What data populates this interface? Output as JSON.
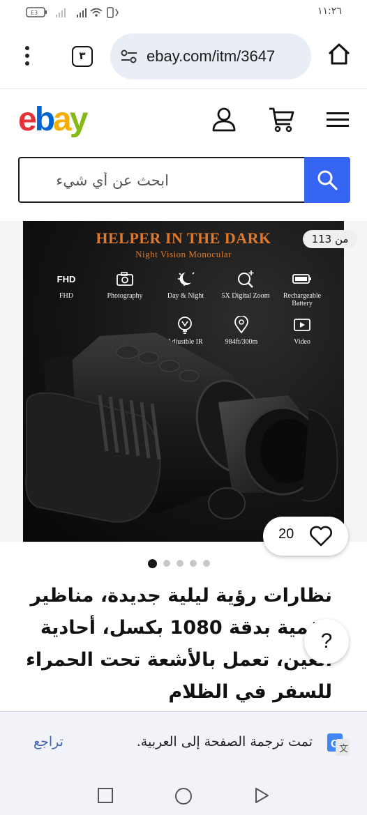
{
  "status_bar": {
    "time": "١١:٢٦"
  },
  "browser": {
    "tab_count": "٣",
    "url": "ebay.com/itm/3647"
  },
  "ebay": {
    "logo_text": [
      "e",
      "b",
      "a",
      "y"
    ],
    "brand_colors": [
      "#e53238",
      "#0064d2",
      "#f5af02",
      "#86b817"
    ],
    "search_placeholder": "ابحث عن أي شيء",
    "search_button_color": "#3665f3"
  },
  "gallery": {
    "image_counter": "من 113",
    "headline": "HELPER IN THE DARK",
    "subline": "Night Vision Monocular",
    "features": [
      {
        "label": "FHD",
        "icon": "fhd-icon"
      },
      {
        "label": "Photography",
        "icon": "camera-icon"
      },
      {
        "label": "Day & Night",
        "icon": "day-night-icon"
      },
      {
        "label": "5X Digital Zoom",
        "icon": "zoom-icon"
      },
      {
        "label": "Rechargeable Battery",
        "icon": "battery-icon"
      },
      {
        "label": "Adjustble IR",
        "icon": "ir-icon"
      },
      {
        "label": "984ft/300m",
        "icon": "location-icon"
      },
      {
        "label": "Video",
        "icon": "video-icon"
      }
    ],
    "watch_count": "20",
    "page_dots": 5,
    "active_dot": 0
  },
  "product": {
    "title": "نظارات رؤية ليلية جديدة، مناظير رقمية بدقة 1080 بكسل، أحادية العين، تعمل بالأشعة تحت الحمراء للسفر في الظلام"
  },
  "help_button": "?",
  "translate_bar": {
    "message": "تمت ترجمة الصفحة إلى العربية.",
    "undo_label": "تراجع"
  }
}
